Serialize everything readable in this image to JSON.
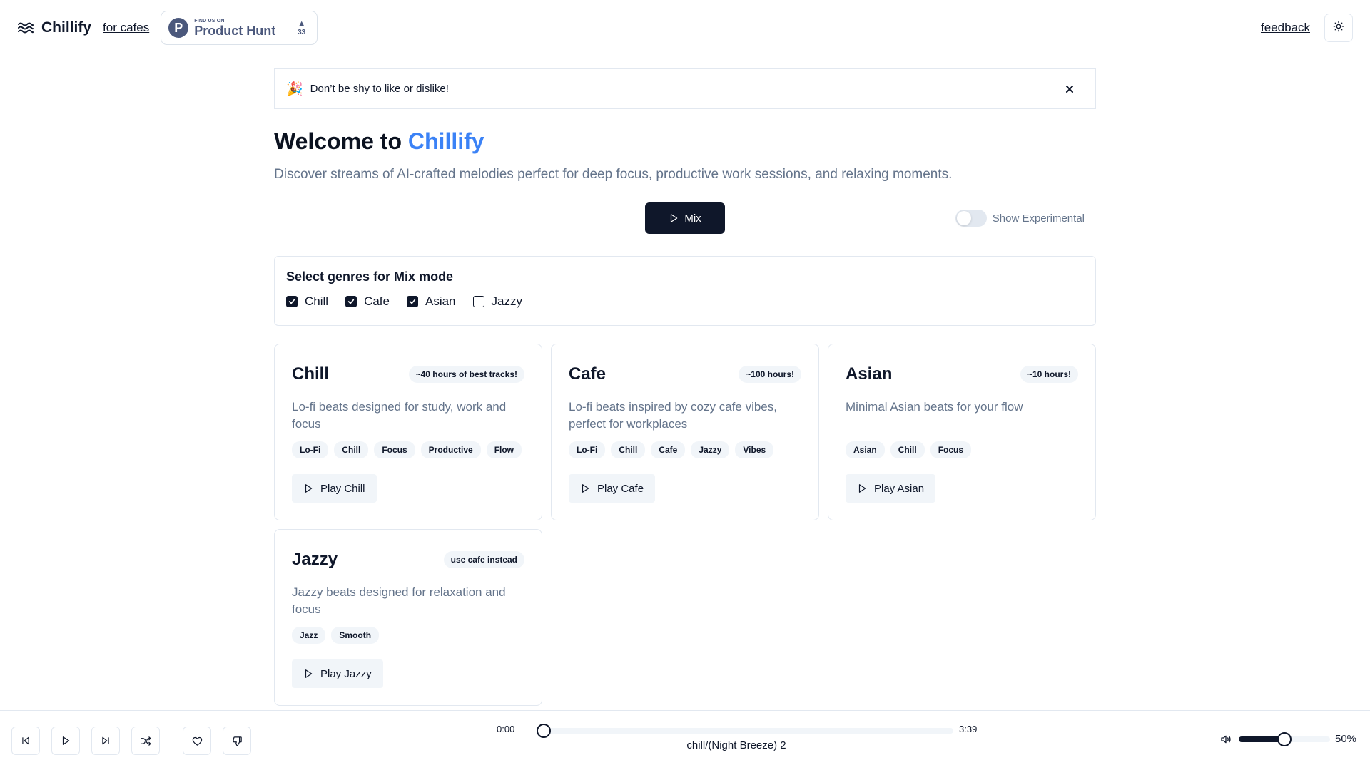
{
  "header": {
    "brand_name": "Chillify",
    "for_cafes_link": "for cafes",
    "product_hunt": {
      "small_text": "FIND US ON",
      "big_text": "Product Hunt",
      "logo_letter": "P",
      "upvote_arrow": "▲",
      "votes": "33"
    },
    "feedback_link": "feedback",
    "theme_toggle_icon": "sun-icon"
  },
  "banner": {
    "emoji": "🎉",
    "text": "Don’t be shy to like or dislike!",
    "close_icon": "close-icon"
  },
  "hero": {
    "title_prefix": "Welcome to ",
    "title_accent": "Chillify",
    "subtitle": "Discover streams of AI-crafted melodies perfect for deep focus, productive work sessions, and relaxing moments.",
    "accent_color": "#3b82f6"
  },
  "actions": {
    "mix_label": "Mix",
    "experimental_label": "Show Experimental",
    "experimental_on": false
  },
  "genre_select": {
    "title": "Select genres for Mix mode",
    "options": [
      {
        "label": "Chill",
        "checked": true
      },
      {
        "label": "Cafe",
        "checked": true
      },
      {
        "label": "Asian",
        "checked": true
      },
      {
        "label": "Jazzy",
        "checked": false
      }
    ]
  },
  "cards": [
    {
      "title": "Chill",
      "badge": "~40 hours of best tracks!",
      "description": "Lo-fi beats designed for study, work and focus",
      "tags": [
        "Lo-Fi",
        "Chill",
        "Focus",
        "Productive",
        "Flow"
      ],
      "play_label": "Play Chill"
    },
    {
      "title": "Cafe",
      "badge": "~100 hours!",
      "description": "Lo-fi beats inspired by cozy cafe vibes, perfect for workplaces",
      "tags": [
        "Lo-Fi",
        "Chill",
        "Cafe",
        "Jazzy",
        "Vibes"
      ],
      "play_label": "Play Cafe"
    },
    {
      "title": "Asian",
      "badge": "~10 hours!",
      "description": "Minimal Asian beats for your flow",
      "tags": [
        "Asian",
        "Chill",
        "Focus"
      ],
      "play_label": "Play Asian"
    },
    {
      "title": "Jazzy",
      "badge": "use cafe instead",
      "description": "Jazzy beats designed for relaxation and focus",
      "tags": [
        "Jazz",
        "Smooth"
      ],
      "play_label": "Play Jazzy"
    }
  ],
  "player": {
    "current_time": "0:00",
    "duration": "3:39",
    "progress": 0,
    "track_name": "chill/(Night Breeze) 2",
    "volume": 0.5,
    "volume_label": "50%",
    "controls": [
      "previous-icon",
      "play-icon",
      "next-icon",
      "shuffle-icon",
      "heart-icon",
      "thumbs-down-icon"
    ]
  }
}
